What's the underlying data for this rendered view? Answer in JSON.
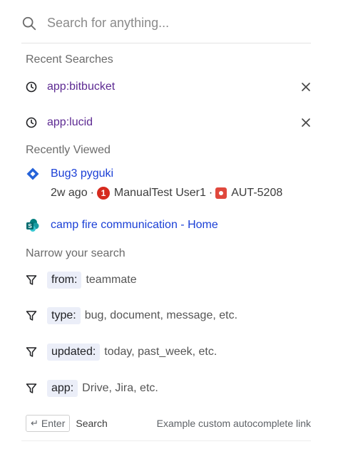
{
  "search": {
    "placeholder": "Search for anything..."
  },
  "recent_searches": {
    "title": "Recent Searches",
    "items": [
      {
        "label": "app:bitbucket"
      },
      {
        "label": "app:lucid"
      }
    ]
  },
  "recently_viewed": {
    "title": "Recently Viewed",
    "items": [
      {
        "title": "Bug3 pyguki",
        "age": "2w ago",
        "user": "ManualTest User1",
        "key": "AUT-5208"
      },
      {
        "title": "camp fire communication - Home"
      }
    ]
  },
  "narrow": {
    "title": "Narrow your search",
    "items": [
      {
        "key": "from:",
        "hint": "teammate"
      },
      {
        "key": "type:",
        "hint": "bug, document, message, etc."
      },
      {
        "key": "updated:",
        "hint": "today, past_week, etc."
      },
      {
        "key": "app:",
        "hint": "Drive, Jira, etc."
      }
    ]
  },
  "footer": {
    "enter_label": "Enter",
    "search_label": "Search",
    "link_label": "Example custom autocomplete link"
  },
  "colors": {
    "link": "#1a3fd6",
    "recent": "#5d2a92",
    "key_bg": "#ebeef8"
  }
}
